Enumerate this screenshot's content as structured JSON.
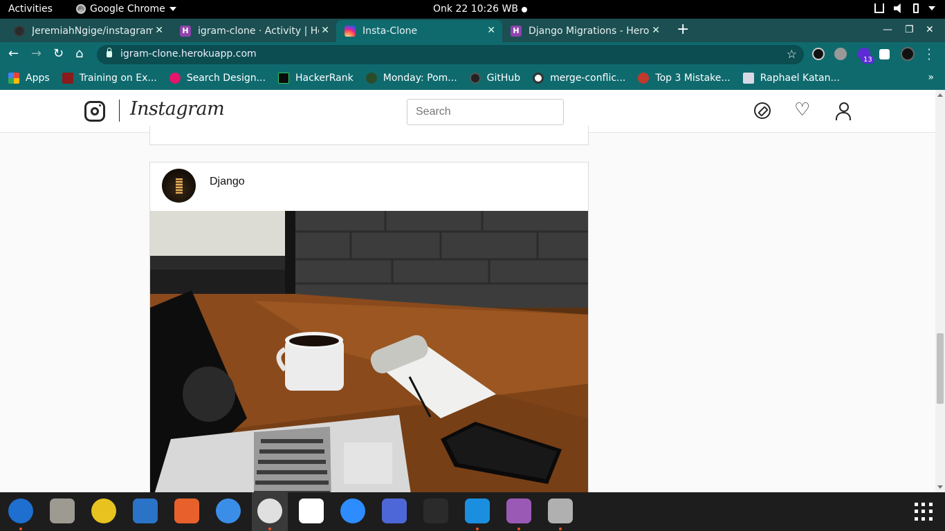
{
  "system_bar": {
    "activities": "Activities",
    "app_name": "Google Chrome",
    "clock": "Onk 22  10:26 WB"
  },
  "tabs": [
    {
      "title": "JeremiahNgige/instagram",
      "favicon": "github-icon",
      "active": false
    },
    {
      "title": "igram-clone · Activity | Heroku",
      "favicon": "heroku-icon",
      "active": false
    },
    {
      "title": "Insta-Clone",
      "favicon": "instagram-icon",
      "active": true
    },
    {
      "title": "Django Migrations - Heroku",
      "favicon": "heroku-icon",
      "active": false
    }
  ],
  "toolbar": {
    "url": "igram-clone.herokuapp.com",
    "extension_badge": "13"
  },
  "bookmarks": [
    {
      "label": "Apps",
      "color": "#ea4335"
    },
    {
      "label": "Training on Ex...",
      "color": "#8b1a1a"
    },
    {
      "label": "Search Design...",
      "color": "#e4156b"
    },
    {
      "label": "HackerRank",
      "color": "#0b0b0b"
    },
    {
      "label": "Monday: Pom...",
      "color": "#2b4c2b"
    },
    {
      "label": "GitHub",
      "color": "#222222"
    },
    {
      "label": "merge-conflic...",
      "color": "#333333"
    },
    {
      "label": "Top 3 Mistake...",
      "color": "#c0392b"
    },
    {
      "label": "Raphael Katan...",
      "color": "#d9d9e6"
    }
  ],
  "instagram": {
    "wordmark": "Instagram",
    "search_placeholder": "Search",
    "post": {
      "username": "Django"
    }
  },
  "colors": {
    "chrome_frame": "#0f6a6e",
    "tab_strip": "#1b4f52",
    "dock_indicator": "#e95420"
  },
  "dock": [
    {
      "name": "thunderbird-icon",
      "color": "#1f6fd1",
      "running": true
    },
    {
      "name": "files-icon",
      "color": "#9d9a92",
      "running": false
    },
    {
      "name": "rhythmbox-icon",
      "color": "#e8c21f",
      "running": false
    },
    {
      "name": "writer-icon",
      "color": "#2a73c7",
      "running": false
    },
    {
      "name": "software-icon",
      "color": "#e8612c",
      "running": false
    },
    {
      "name": "help-icon",
      "color": "#3b8ee8",
      "running": false
    },
    {
      "name": "chrome-icon",
      "color": "#e0e0e0",
      "running": true
    },
    {
      "name": "slack-icon",
      "color": "#ffffff",
      "running": false
    },
    {
      "name": "zoom-icon",
      "color": "#2d8cff",
      "running": false
    },
    {
      "name": "screenshot-icon",
      "color": "#4e67d8",
      "running": false
    },
    {
      "name": "system-monitor-icon",
      "color": "#2b2b2b",
      "running": false
    },
    {
      "name": "vscode-icon",
      "color": "#1a8fe0",
      "running": true
    },
    {
      "name": "video-icon",
      "color": "#9b59b6",
      "running": true
    },
    {
      "name": "image-viewer-icon",
      "color": "#b0b0b0",
      "running": true
    }
  ]
}
